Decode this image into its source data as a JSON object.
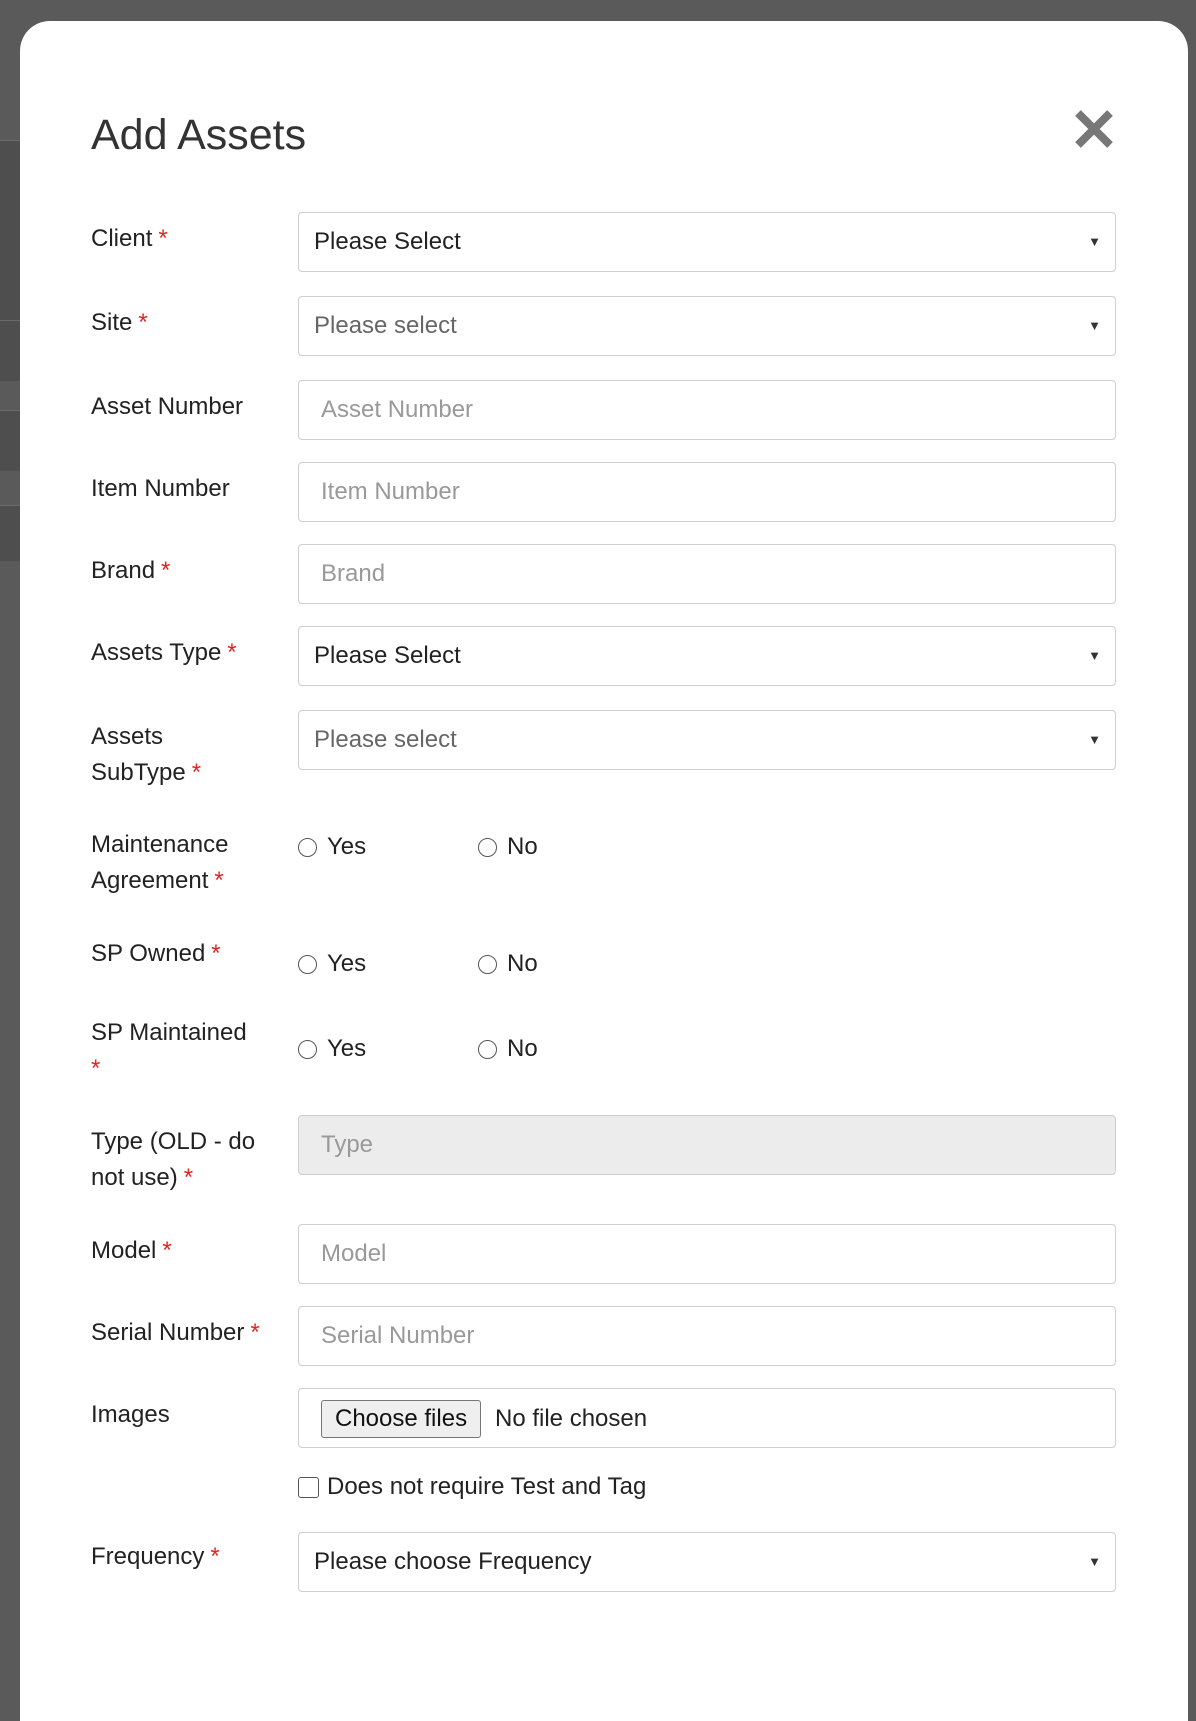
{
  "modal": {
    "title": "Add Assets",
    "close_icon": "close-icon"
  },
  "required_marker": "*",
  "fields": {
    "client": {
      "label": "Client",
      "value": "Please Select"
    },
    "site": {
      "label": "Site",
      "value": "Please select"
    },
    "asset_number": {
      "label": "Asset Number",
      "placeholder": "Asset Number",
      "value": ""
    },
    "item_number": {
      "label": "Item Number",
      "placeholder": "Item Number",
      "value": ""
    },
    "brand": {
      "label": "Brand",
      "placeholder": "Brand",
      "value": ""
    },
    "assets_type": {
      "label": "Assets Type",
      "value": "Please Select"
    },
    "assets_subtype": {
      "label_line1": "Assets",
      "label_line2": "SubType",
      "value": "Please select"
    },
    "maintenance_agreement": {
      "label_line1": "Maintenance",
      "label_line2": "Agreement",
      "yes": "Yes",
      "no": "No"
    },
    "sp_owned": {
      "label": "SP Owned",
      "yes": "Yes",
      "no": "No"
    },
    "sp_maintained": {
      "label": "SP Maintained",
      "yes": "Yes",
      "no": "No"
    },
    "type_old": {
      "label_line1": "Type (OLD - do",
      "label_line2": "not use)",
      "placeholder": "Type",
      "value": ""
    },
    "model": {
      "label": "Model",
      "placeholder": "Model",
      "value": ""
    },
    "serial_number": {
      "label": "Serial Number",
      "placeholder": "Serial Number",
      "value": ""
    },
    "images": {
      "label": "Images",
      "button": "Choose files",
      "status": "No file chosen"
    },
    "test_and_tag": {
      "label": "Does not require Test and Tag"
    },
    "frequency": {
      "label": "Frequency",
      "value": "Please choose Frequency"
    }
  }
}
